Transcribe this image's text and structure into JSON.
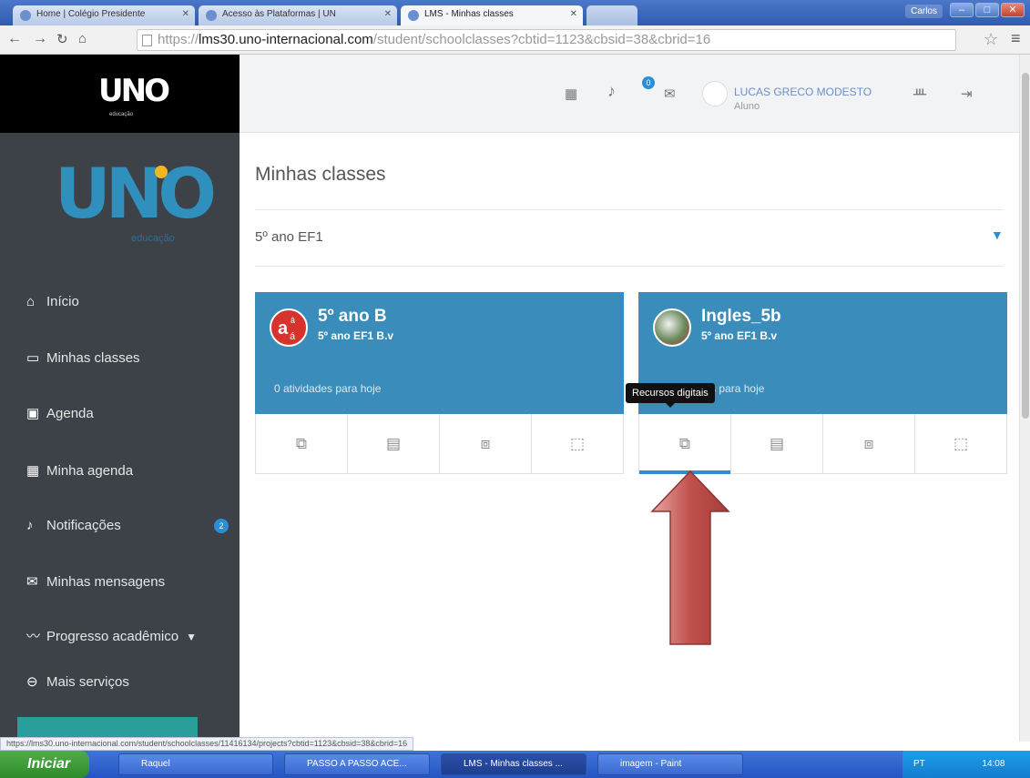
{
  "browser": {
    "tabs": [
      {
        "label": "Home | Colégio Presidente",
        "active": false
      },
      {
        "label": "Acesso às Plataformas | UN",
        "active": false
      },
      {
        "label": "LMS - Minhas classes",
        "active": true
      }
    ],
    "url_prefix": "https://",
    "url_host": "lms30.uno-internacional.com",
    "url_rest": "/student/schoolclasses?cbtid=1123&cbsid=38&cbrid=16",
    "warn_chip": "Carlos",
    "status_url": "https://lms30.uno-internacional.com/student/schoolclasses/11416134/projects?cbtid=1123&cbsid=38&cbrid=16"
  },
  "sidebar": {
    "logo_brand": "UNO",
    "logo_sub": "educação",
    "big_logo": "UNO",
    "big_logo_sub": "educação",
    "items": [
      {
        "label": "Início",
        "icon": "home-icon"
      },
      {
        "label": "Minhas classes",
        "icon": "chat-icon"
      },
      {
        "label": "Agenda",
        "icon": "calendar-icon"
      },
      {
        "label": "Minha agenda",
        "icon": "calendar-grid-icon"
      },
      {
        "label": "Notificações",
        "icon": "bell-icon",
        "badge": "2"
      },
      {
        "label": "Minhas mensagens",
        "icon": "mail-icon"
      },
      {
        "label": "Progresso acadêmico",
        "icon": "chart-line-icon"
      },
      {
        "label": "Mais serviços",
        "icon": "minus-circle-icon"
      }
    ]
  },
  "header": {
    "user_name": "LUCAS GRECO MODESTO",
    "user_role": "Aluno",
    "notif_badge": "0"
  },
  "main": {
    "title": "Minhas classes",
    "select_value": "5º ano EF1",
    "cards": [
      {
        "title": "5º ano B",
        "subtitle": "5º ano EF1 B.v",
        "activities": "0 atividades para hoje"
      },
      {
        "title": "Ingles_5b",
        "subtitle": "5º ano EF1 B.v",
        "activities": "0 atividades para hoje"
      }
    ],
    "tooltip": "Recursos digitais"
  },
  "taskbar": {
    "start_label": "Iniciar",
    "items": [
      {
        "label": "Raquel"
      },
      {
        "label": "PASSO A PASSO ACE..."
      },
      {
        "label": "LMS - Minhas classes ..."
      },
      {
        "label": "imagem - Paint"
      }
    ],
    "lang": "PT",
    "clock": "14:08"
  },
  "colors": {
    "accent": "#3a8dba",
    "badge": "#2a8fd6",
    "sidebar": "#3d4249",
    "arrow": "#c0504d"
  }
}
